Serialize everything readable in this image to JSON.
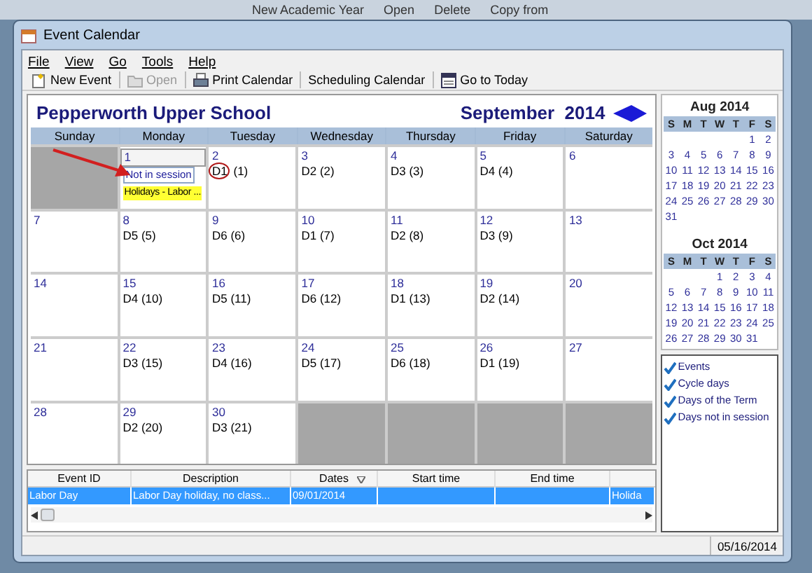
{
  "background_window": {
    "menu": [
      "New Academic Year",
      "Open",
      "Delete",
      "Copy from"
    ]
  },
  "window": {
    "title": "Event Calendar"
  },
  "menu": [
    "File",
    "View",
    "Go",
    "Tools",
    "Help"
  ],
  "toolbar": [
    {
      "label": "New Event",
      "kind": "new",
      "disabled": false
    },
    {
      "label": "Open",
      "kind": "open",
      "disabled": true
    },
    {
      "label": "Print Calendar",
      "kind": "print",
      "disabled": false
    },
    {
      "label": "Scheduling Calendar",
      "kind": "text",
      "disabled": false
    },
    {
      "label": "Go to Today",
      "kind": "today",
      "disabled": false
    }
  ],
  "calendar": {
    "school": "Pepperworth Upper School",
    "month": "September  2014",
    "weekdays": [
      "Sunday",
      "Monday",
      "Tuesday",
      "Wednesday",
      "Thursday",
      "Friday",
      "Saturday"
    ],
    "weeks": [
      [
        {
          "outside": true
        },
        {
          "outside": false,
          "selected": true,
          "day": "1",
          "events": [
            {
              "text": "Not in session",
              "kind": "status"
            },
            {
              "text": "Holidays - Labor ...",
              "kind": "holiday"
            }
          ]
        },
        {
          "outside": false,
          "selected": false,
          "day": "2",
          "cycle": {
            "label": "D1",
            "count": "(1)",
            "circled": true
          }
        },
        {
          "outside": false,
          "selected": false,
          "day": "3",
          "cycle": {
            "label": "D2",
            "count": "(2)",
            "circled": false
          }
        },
        {
          "outside": false,
          "selected": false,
          "day": "4",
          "cycle": {
            "label": "D3",
            "count": "(3)",
            "circled": false
          }
        },
        {
          "outside": false,
          "selected": false,
          "day": "5",
          "cycle": {
            "label": "D4",
            "count": "(4)",
            "circled": false
          }
        },
        {
          "outside": false,
          "selected": false,
          "day": "6"
        }
      ],
      [
        {
          "outside": false,
          "selected": false,
          "day": "7"
        },
        {
          "outside": false,
          "selected": false,
          "day": "8",
          "cycle": {
            "label": "D5",
            "count": "(5)",
            "circled": false
          }
        },
        {
          "outside": false,
          "selected": false,
          "day": "9",
          "cycle": {
            "label": "D6",
            "count": "(6)",
            "circled": false
          }
        },
        {
          "outside": false,
          "selected": false,
          "day": "10",
          "cycle": {
            "label": "D1",
            "count": "(7)",
            "circled": false
          }
        },
        {
          "outside": false,
          "selected": false,
          "day": "11",
          "cycle": {
            "label": "D2",
            "count": "(8)",
            "circled": false
          }
        },
        {
          "outside": false,
          "selected": false,
          "day": "12",
          "cycle": {
            "label": "D3",
            "count": "(9)",
            "circled": false
          }
        },
        {
          "outside": false,
          "selected": false,
          "day": "13"
        }
      ],
      [
        {
          "outside": false,
          "selected": false,
          "day": "14"
        },
        {
          "outside": false,
          "selected": false,
          "day": "15",
          "cycle": {
            "label": "D4",
            "count": "(10)",
            "circled": false
          }
        },
        {
          "outside": false,
          "selected": false,
          "day": "16",
          "cycle": {
            "label": "D5",
            "count": "(11)",
            "circled": false
          }
        },
        {
          "outside": false,
          "selected": false,
          "day": "17",
          "cycle": {
            "label": "D6",
            "count": "(12)",
            "circled": false
          }
        },
        {
          "outside": false,
          "selected": false,
          "day": "18",
          "cycle": {
            "label": "D1",
            "count": "(13)",
            "circled": false
          }
        },
        {
          "outside": false,
          "selected": false,
          "day": "19",
          "cycle": {
            "label": "D2",
            "count": "(14)",
            "circled": false
          }
        },
        {
          "outside": false,
          "selected": false,
          "day": "20"
        }
      ],
      [
        {
          "outside": false,
          "selected": false,
          "day": "21"
        },
        {
          "outside": false,
          "selected": false,
          "day": "22",
          "cycle": {
            "label": "D3",
            "count": "(15)",
            "circled": false
          }
        },
        {
          "outside": false,
          "selected": false,
          "day": "23",
          "cycle": {
            "label": "D4",
            "count": "(16)",
            "circled": false
          }
        },
        {
          "outside": false,
          "selected": false,
          "day": "24",
          "cycle": {
            "label": "D5",
            "count": "(17)",
            "circled": false
          }
        },
        {
          "outside": false,
          "selected": false,
          "day": "25",
          "cycle": {
            "label": "D6",
            "count": "(18)",
            "circled": false
          }
        },
        {
          "outside": false,
          "selected": false,
          "day": "26",
          "cycle": {
            "label": "D1",
            "count": "(19)",
            "circled": false
          }
        },
        {
          "outside": false,
          "selected": false,
          "day": "27"
        }
      ],
      [
        {
          "outside": false,
          "selected": false,
          "day": "28"
        },
        {
          "outside": false,
          "selected": false,
          "day": "29",
          "cycle": {
            "label": "D2",
            "count": "(20)",
            "circled": false
          }
        },
        {
          "outside": false,
          "selected": false,
          "day": "30",
          "cycle": {
            "label": "D3",
            "count": "(21)",
            "circled": false
          }
        },
        {
          "outside": true
        },
        {
          "outside": true
        },
        {
          "outside": true
        },
        {
          "outside": true
        }
      ]
    ]
  },
  "mini_calendars": [
    {
      "title": "Aug 2014",
      "weekdays": [
        "S",
        "M",
        "T",
        "W",
        "T",
        "F",
        "S"
      ],
      "weeks": [
        [
          "1",
          "2"
        ],
        [
          "3",
          "4",
          "5",
          "6",
          "7",
          "8",
          "9"
        ],
        [
          "10",
          "11",
          "12",
          "13",
          "14",
          "15",
          "16"
        ],
        [
          "17",
          "18",
          "19",
          "20",
          "21",
          "22",
          "23"
        ],
        [
          "24",
          "25",
          "26",
          "27",
          "28",
          "29",
          "30"
        ],
        [
          "31"
        ]
      ]
    },
    {
      "title": "Oct 2014",
      "weekdays": [
        "S",
        "M",
        "T",
        "W",
        "T",
        "F",
        "S"
      ],
      "weeks": [
        [
          "1",
          "2",
          "3",
          "4"
        ],
        [
          "5",
          "6",
          "7",
          "8",
          "9",
          "10",
          "11"
        ],
        [
          "12",
          "13",
          "14",
          "15",
          "16",
          "17",
          "18"
        ],
        [
          "19",
          "20",
          "21",
          "22",
          "23",
          "24",
          "25"
        ],
        [
          "26",
          "27",
          "28",
          "29",
          "30",
          "31"
        ]
      ]
    }
  ],
  "legend": [
    {
      "label": "Events",
      "checked": true
    },
    {
      "label": "Cycle days",
      "checked": true
    },
    {
      "label": "Days of the Term",
      "checked": true
    },
    {
      "label": "Days not in session",
      "checked": true
    }
  ],
  "table": {
    "columns": [
      {
        "label": "Event ID",
        "sorted": false
      },
      {
        "label": "Description",
        "sorted": false
      },
      {
        "label": "Dates",
        "sorted": true
      },
      {
        "label": "Start time",
        "sorted": false
      },
      {
        "label": "End time",
        "sorted": false
      },
      {}
    ],
    "rows": [
      {
        "selected": true,
        "event_id": "Labor Day",
        "description": "Labor Day holiday, no class...",
        "dates": "09/01/2014",
        "column_6": "Holida"
      }
    ]
  },
  "status_bar": {
    "date": "05/16/2014"
  }
}
